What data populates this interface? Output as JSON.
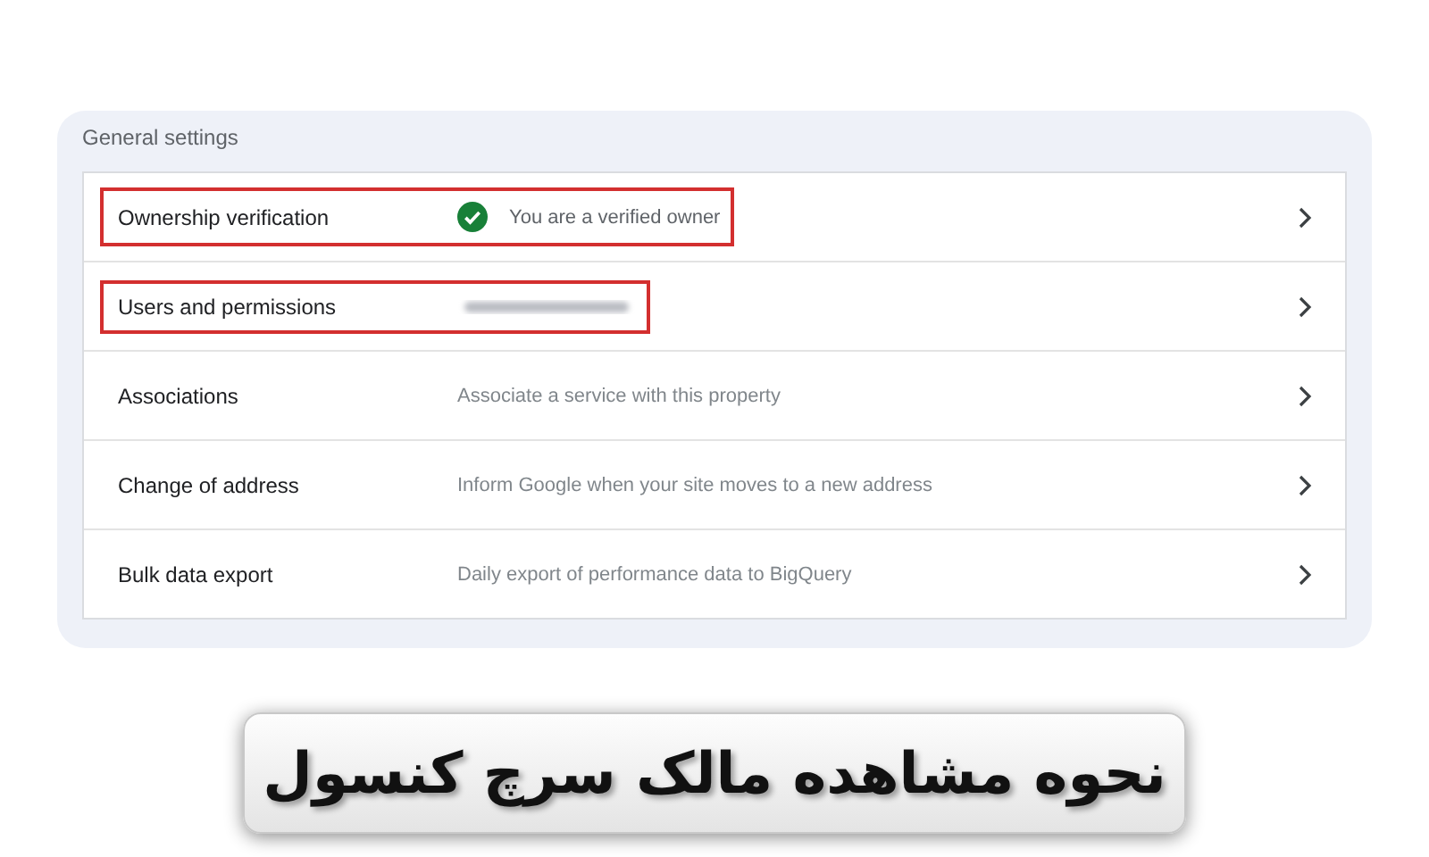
{
  "section_title": "General settings",
  "rows": [
    {
      "label": "Ownership verification",
      "kind": "verified",
      "value": "You are a verified owner",
      "highlighted": true
    },
    {
      "label": "Users and permissions",
      "kind": "redacted",
      "highlighted": true
    },
    {
      "label": "Associations",
      "kind": "text",
      "value": "Associate a service with this property",
      "highlighted": false
    },
    {
      "label": "Change of address",
      "kind": "text",
      "value": "Inform Google when your site moves to a new address",
      "highlighted": false
    },
    {
      "label": "Bulk data export",
      "kind": "text",
      "value": "Daily export of performance data to BigQuery",
      "highlighted": false
    }
  ],
  "banner": {
    "title": "نحوه مشاهده مالک سرچ کنسول"
  }
}
